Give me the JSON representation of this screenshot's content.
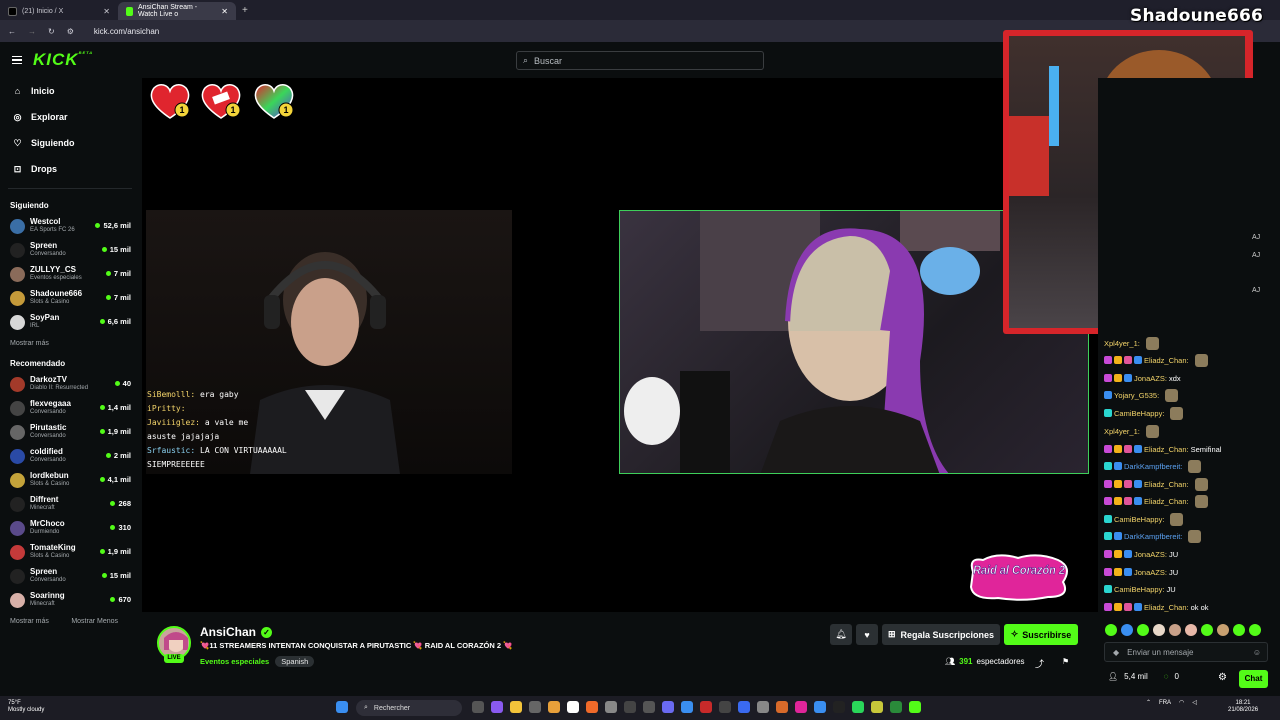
{
  "browser": {
    "tabs": [
      {
        "label": "(21) Inicio / X",
        "active": false
      },
      {
        "label": "AnsiChan Stream - Watch Live o",
        "active": true
      }
    ],
    "url": "kick.com/ansichan"
  },
  "header": {
    "logo": "KICK",
    "logo_sup": "BETA",
    "search_placeholder": "Buscar"
  },
  "sidebar": {
    "nav": [
      {
        "label": "Inicio",
        "icon": "home-icon"
      },
      {
        "label": "Explorar",
        "icon": "compass-icon"
      },
      {
        "label": "Siguiendo",
        "icon": "heart-icon"
      },
      {
        "label": "Drops",
        "icon": "gift-icon"
      }
    ],
    "following_title": "Siguiendo",
    "following": [
      {
        "name": "Westcol",
        "category": "EA Sports FC 26",
        "viewers": "52,6 mil",
        "color": "#3a6ea5"
      },
      {
        "name": "Spreen",
        "category": "Conversando",
        "viewers": "15 mil",
        "color": "#222222"
      },
      {
        "name": "ZULLYY_CS",
        "category": "Eventos especiales",
        "viewers": "7 mil",
        "color": "#8a6b5a"
      },
      {
        "name": "Shadoune666",
        "category": "Slots & Casino",
        "viewers": "7 mil",
        "color": "#c49a3a"
      },
      {
        "name": "SoyPan",
        "category": "IRL",
        "viewers": "6,6 mil",
        "color": "#d7d7d7"
      }
    ],
    "following_more": "Mostrar más",
    "recommended_title": "Recomendado",
    "recommended": [
      {
        "name": "DarkozTV",
        "category": "Diablo II: Resurrected",
        "viewers": "40",
        "color": "#a33a2a"
      },
      {
        "name": "flexvegaaa",
        "category": "Conversando",
        "viewers": "1,4 mil",
        "color": "#444"
      },
      {
        "name": "Pirutastic",
        "category": "Conversando",
        "viewers": "1,9 mil",
        "color": "#666"
      },
      {
        "name": "coldified",
        "category": "Conversando",
        "viewers": "2 mil",
        "color": "#2a4aa5"
      },
      {
        "name": "lordkebun",
        "category": "Slots & Casino",
        "viewers": "4,1 mil",
        "color": "#c4a33a"
      },
      {
        "name": "Diffrent",
        "category": "Minecraft",
        "viewers": "268",
        "color": "#222"
      },
      {
        "name": "MrChoco",
        "category": "Durmiendo",
        "viewers": "310",
        "color": "#5a4a8a"
      },
      {
        "name": "TomateKing",
        "category": "Slots & Casino",
        "viewers": "1,9 mil",
        "color": "#c43a3a"
      },
      {
        "name": "Spreen",
        "category": "Conversando",
        "viewers": "15 mil",
        "color": "#222"
      },
      {
        "name": "Soarinng",
        "category": "Minecraft",
        "viewers": "670",
        "color": "#d8b0a8"
      }
    ],
    "show_more": "Mostrar más",
    "show_less": "Mostrar Menos"
  },
  "player": {
    "gift_count": "1",
    "overlay_chat": [
      {
        "user": "SiBemolll:",
        "text": "era gaby"
      },
      {
        "user": "iPritty:",
        "text": ""
      },
      {
        "user": "Javiiiglez:",
        "text": "a vale me asuste jajajaja"
      },
      {
        "user": "Srfaustic:",
        "text": "LA      CON VIRTUAAAAAL SIEMPREEEEEE"
      }
    ],
    "raid_logo": "Raid al Corazón 2"
  },
  "facecam": {
    "name": "Shadoune666"
  },
  "stream": {
    "channel": "AnsiChan",
    "live_label": "LIVE",
    "title": "💘11 STREAMERS INTENTAN CONQUISTAR A PIRUTASTIC 💘 RAID AL CORAZÓN 2 💘",
    "category": "Eventos especiales",
    "language": "Spanish",
    "gift_button": "Regala Suscripciones",
    "subscribe_button": "Suscribirse",
    "viewers": "391",
    "viewers_label": "espectadores"
  },
  "chat": {
    "messages": [
      {
        "user": "Xpl4yer_1:",
        "color": "#f3d46a",
        "text": "",
        "badges": []
      },
      {
        "user": "Eliadz_Chan:",
        "color": "#f3d46a",
        "text": "",
        "badges": [
          "#c84ad6",
          "#f3b21a",
          "#e0559a",
          "#3a8ef0"
        ]
      },
      {
        "user": "JonaAZS:",
        "color": "#f3d46a",
        "text": "xdx",
        "badges": [
          "#c84ad6",
          "#f3b21a",
          "#3a8ef0"
        ]
      },
      {
        "user": "Yojary_G535:",
        "color": "#f3d46a",
        "text": "",
        "badges": [
          "#3a8ef0"
        ]
      },
      {
        "user": "CamiBeHappy:",
        "color": "#f3d46a",
        "text": "",
        "badges": [
          "#2ad6d0"
        ]
      },
      {
        "user": "Xpl4yer_1:",
        "color": "#f3d46a",
        "text": "",
        "badges": []
      },
      {
        "user": "Eliadz_Chan:",
        "color": "#f3d46a",
        "text": "Semifinal",
        "badges": [
          "#c84ad6",
          "#f3b21a",
          "#e0559a",
          "#3a8ef0"
        ]
      },
      {
        "user": "DarkKampfbereit:",
        "color": "#5aa0f0",
        "text": "",
        "badges": [
          "#2ad6d0",
          "#3a8ef0"
        ]
      },
      {
        "user": "Eliadz_Chan:",
        "color": "#f3d46a",
        "text": "",
        "badges": [
          "#c84ad6",
          "#f3b21a",
          "#e0559a",
          "#3a8ef0"
        ]
      },
      {
        "user": "Eliadz_Chan:",
        "color": "#f3d46a",
        "text": "",
        "badges": [
          "#c84ad6",
          "#f3b21a",
          "#e0559a",
          "#3a8ef0"
        ]
      },
      {
        "user": "CamiBeHappy:",
        "color": "#f3d46a",
        "text": "",
        "badges": [
          "#2ad6d0"
        ]
      },
      {
        "user": "DarkKampfbereit:",
        "color": "#5aa0f0",
        "text": "",
        "badges": [
          "#2ad6d0",
          "#3a8ef0"
        ]
      },
      {
        "user": "JonaAZS:",
        "color": "#f3d46a",
        "text": "JU",
        "badges": [
          "#c84ad6",
          "#f3b21a",
          "#3a8ef0"
        ]
      },
      {
        "user": "JonaAZS:",
        "color": "#f3d46a",
        "text": "JU",
        "badges": [
          "#c84ad6",
          "#f3b21a",
          "#3a8ef0"
        ]
      },
      {
        "user": "CamiBeHappy:",
        "color": "#f3d46a",
        "text": "JU",
        "badges": [
          "#2ad6d0"
        ]
      },
      {
        "user": "Eliadz_Chan:",
        "color": "#f3d46a",
        "text": "ok ok",
        "badges": [
          "#c84ad6",
          "#f3b21a",
          "#e0559a",
          "#3a8ef0"
        ]
      }
    ],
    "cut_text": [
      "AJ",
      "AJ",
      "AJ"
    ],
    "input_placeholder": "Enviar un mensaje",
    "followers": "5,4 mil",
    "points": "0",
    "chat_button": "Chat"
  },
  "taskbar": {
    "weather_temp": "75°F",
    "weather_desc": "Mostly cloudy",
    "search_label": "Rechercher",
    "lang": "FRA",
    "time": "18:21",
    "date": "21/08/2026"
  },
  "colors": {
    "accent": "#53fc18",
    "background": "#0b0e0f",
    "facecam_frame": "#d6252a"
  }
}
